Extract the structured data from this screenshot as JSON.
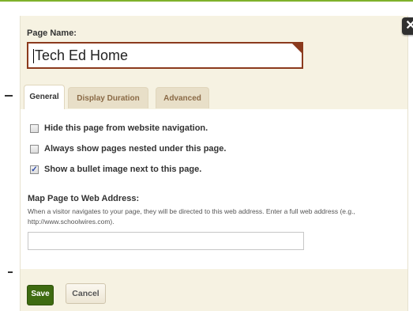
{
  "dialog": {
    "close_glyph": "✕",
    "page_name": {
      "label": "Page Name:",
      "value": "Tech Ed Home"
    },
    "tabs": [
      {
        "label": "General"
      },
      {
        "label": "Display Duration"
      },
      {
        "label": "Advanced"
      }
    ],
    "options": [
      {
        "label": "Hide this page from website navigation.",
        "checked": false
      },
      {
        "label": "Always show pages nested under this page.",
        "checked": false
      },
      {
        "label": "Show a bullet image next to this page.",
        "checked": true
      }
    ],
    "map": {
      "label": "Map Page to Web Address:",
      "description": "When a visitor navigates to your page, they will be directed to this web address. Enter a full web address (e.g., http://www.schoolwires.com).",
      "value": ""
    },
    "footer": {
      "save_label": "Save",
      "cancel_label": "Cancel"
    }
  },
  "colors": {
    "accent_green": "#7fb12b",
    "save_green": "#3e6b11",
    "input_border": "#8b3a1d",
    "panel_bg": "#f6f2e2",
    "tab_text": "#8a6a46"
  },
  "icons": [
    "close-icon",
    "checkbox-icon",
    "checkmark-icon"
  ]
}
